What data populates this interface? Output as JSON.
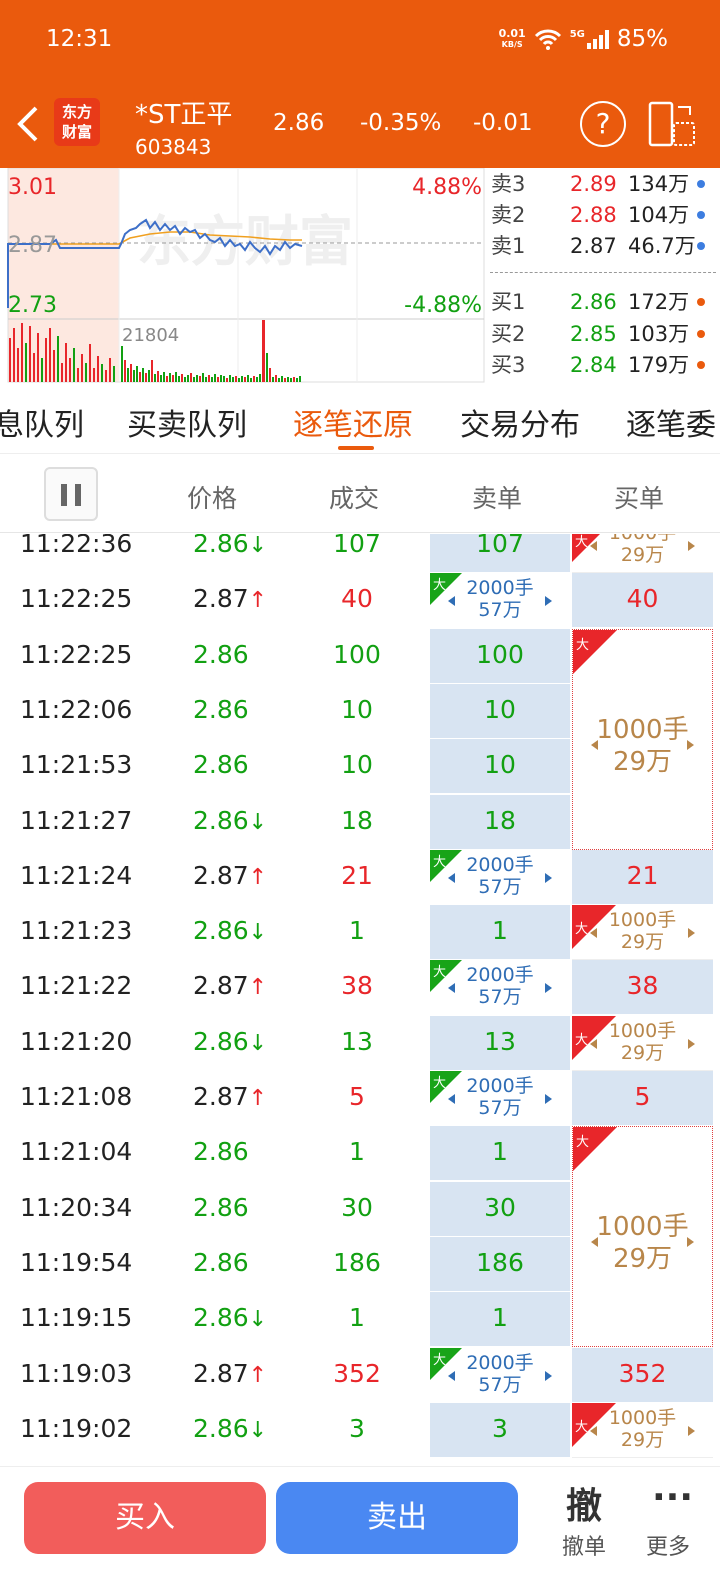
{
  "status_bar": {
    "time": "12:31",
    "net_speed_value": "0.01",
    "net_speed_unit": "KB/S",
    "net_type": "5G",
    "battery": "85%"
  },
  "header": {
    "logo_line1": "东方",
    "logo_line2": "财富",
    "stock_name": "*ST正平",
    "stock_code": "603843",
    "price": "2.86",
    "change_pct": "-0.35%",
    "change": "-0.01",
    "help_symbol": "?"
  },
  "chart": {
    "price_high": "3.01",
    "price_mid": "2.87",
    "price_low": "2.73",
    "pct_high": "4.88%",
    "pct_low": "-4.88%",
    "volume_label": "21804",
    "watermark": "东方财富"
  },
  "order_book": {
    "asks": [
      {
        "label": "卖3",
        "price": "2.89",
        "volume": "134万",
        "price_color": "#e8262a",
        "dot_color": "#3d7de0"
      },
      {
        "label": "卖2",
        "price": "2.88",
        "volume": "104万",
        "price_color": "#e8262a",
        "dot_color": "#3d7de0"
      },
      {
        "label": "卖1",
        "price": "2.87",
        "volume": "46.7万",
        "price_color": "#222222",
        "dot_color": "#3d7de0"
      }
    ],
    "bids": [
      {
        "label": "买1",
        "price": "2.86",
        "volume": "172万",
        "price_color": "#12a012",
        "dot_color": "#ea5a0d"
      },
      {
        "label": "买2",
        "price": "2.85",
        "volume": "103万",
        "price_color": "#12a012",
        "dot_color": "#ea5a0d"
      },
      {
        "label": "买3",
        "price": "2.84",
        "volume": "179万",
        "price_color": "#12a012",
        "dot_color": "#ea5a0d"
      }
    ]
  },
  "tabs": [
    "息队列",
    "买卖队列",
    "逐笔还原",
    "交易分布",
    "逐笔委"
  ],
  "active_tab": 2,
  "columns": {
    "price": "价格",
    "volume": "成交",
    "sell": "卖单",
    "buy": "买单"
  },
  "colors": {
    "up": "#e8262a",
    "down": "#12a012",
    "neutral": "#222222",
    "accent": "#ea5a0d",
    "cell_bg": "#d8e4f2",
    "big_sell": "#2f6db5",
    "big_buy": "#b8864a"
  },
  "big_sell_order": {
    "tag": "大",
    "lots": "2000手",
    "amount": "57万"
  },
  "big_buy_order": {
    "tag": "大",
    "lots": "1000手",
    "amount": "29万"
  },
  "trades": [
    {
      "time": "11:22:36",
      "price": "2.86",
      "arrow": "↓",
      "dir": "down",
      "volume": "107",
      "sell": "107",
      "buy": null
    },
    {
      "time": "11:22:25",
      "price": "2.87",
      "arrow": "↑",
      "dir": "up",
      "volume": "40",
      "sell": null,
      "buy": "40"
    },
    {
      "time": "11:22:25",
      "price": "2.86",
      "arrow": "",
      "dir": "down",
      "volume": "100",
      "sell": "100",
      "buy": null
    },
    {
      "time": "11:22:06",
      "price": "2.86",
      "arrow": "",
      "dir": "down",
      "volume": "10",
      "sell": "10",
      "buy": null
    },
    {
      "time": "11:21:53",
      "price": "2.86",
      "arrow": "",
      "dir": "down",
      "volume": "10",
      "sell": "10",
      "buy": null
    },
    {
      "time": "11:21:27",
      "price": "2.86",
      "arrow": "↓",
      "dir": "down",
      "volume": "18",
      "sell": "18",
      "buy": null
    },
    {
      "time": "11:21:24",
      "price": "2.87",
      "arrow": "↑",
      "dir": "up",
      "volume": "21",
      "sell": null,
      "buy": "21"
    },
    {
      "time": "11:21:23",
      "price": "2.86",
      "arrow": "↓",
      "dir": "down",
      "volume": "1",
      "sell": "1",
      "buy": null
    },
    {
      "time": "11:21:22",
      "price": "2.87",
      "arrow": "↑",
      "dir": "up",
      "volume": "38",
      "sell": null,
      "buy": "38"
    },
    {
      "time": "11:21:20",
      "price": "2.86",
      "arrow": "↓",
      "dir": "down",
      "volume": "13",
      "sell": "13",
      "buy": null
    },
    {
      "time": "11:21:08",
      "price": "2.87",
      "arrow": "↑",
      "dir": "up",
      "volume": "5",
      "sell": null,
      "buy": "5"
    },
    {
      "time": "11:21:04",
      "price": "2.86",
      "arrow": "",
      "dir": "down",
      "volume": "1",
      "sell": "1",
      "buy": null
    },
    {
      "time": "11:20:34",
      "price": "2.86",
      "arrow": "",
      "dir": "down",
      "volume": "30",
      "sell": "30",
      "buy": null
    },
    {
      "time": "11:19:54",
      "price": "2.86",
      "arrow": "",
      "dir": "down",
      "volume": "186",
      "sell": "186",
      "buy": null
    },
    {
      "time": "11:19:15",
      "price": "2.86",
      "arrow": "↓",
      "dir": "down",
      "volume": "1",
      "sell": "1",
      "buy": null
    },
    {
      "time": "11:19:03",
      "price": "2.87",
      "arrow": "↑",
      "dir": "up",
      "volume": "352",
      "sell": null,
      "buy": "352"
    },
    {
      "time": "11:19:02",
      "price": "2.86",
      "arrow": "↓",
      "dir": "down",
      "volume": "3",
      "sell": "3",
      "buy": null
    }
  ],
  "bottom_bar": {
    "buy_label": "买入",
    "sell_label": "卖出",
    "cancel_icon": "撤",
    "cancel_label": "撤单",
    "more_icon": "···",
    "more_label": "更多"
  }
}
